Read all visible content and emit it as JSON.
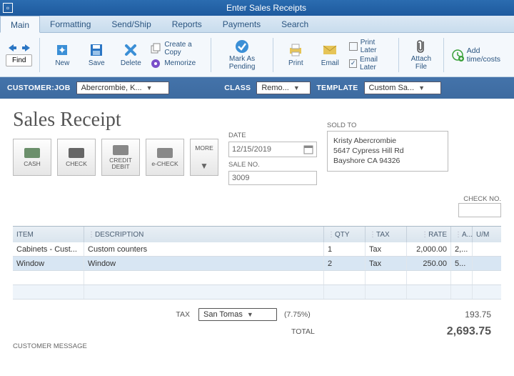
{
  "window": {
    "title": "Enter Sales Receipts"
  },
  "tabs": [
    "Main",
    "Formatting",
    "Send/Ship",
    "Reports",
    "Payments",
    "Search"
  ],
  "ribbon": {
    "find": "Find",
    "new": "New",
    "save": "Save",
    "delete": "Delete",
    "create_copy": "Create a Copy",
    "memorize": "Memorize",
    "mark_pending": "Mark As Pending",
    "print": "Print",
    "email": "Email",
    "print_later": "Print Later",
    "email_later": "Email Later",
    "attach_file": "Attach File",
    "add_time": "Add time/costs"
  },
  "custbar": {
    "customer_label": "CUSTOMER:JOB",
    "customer": "Abercrombie, K...",
    "class_label": "CLASS",
    "class": "Remo...",
    "template_label": "TEMPLATE",
    "template": "Custom Sa..."
  },
  "receipt": {
    "heading": "Sales Receipt",
    "pay": {
      "cash": "CASH",
      "check": "CHECK",
      "credit": "CREDIT DEBIT",
      "echeck": "e-CHECK",
      "more": "MORE"
    },
    "date_label": "DATE",
    "date": "12/15/2019",
    "saleno_label": "SALE NO.",
    "saleno": "3009",
    "soldto_label": "SOLD TO",
    "soldto_line1": "Kristy Abercrombie",
    "soldto_line2": "5647 Cypress Hill Rd",
    "soldto_line3": "Bayshore CA 94326",
    "checkno_label": "CHECK NO."
  },
  "grid": {
    "headers": {
      "item": "ITEM",
      "desc": "DESCRIPTION",
      "qty": "QTY",
      "tax": "TAX",
      "rate": "RATE",
      "a": "A...",
      "um": "U/M"
    },
    "rows": [
      {
        "item": "Cabinets - Cust...",
        "desc": "Custom counters",
        "qty": "1",
        "tax": "Tax",
        "rate": "2,000.00",
        "a": "2,..."
      },
      {
        "item": "Window",
        "desc": "Window",
        "qty": "2",
        "tax": "Tax",
        "rate": "250.00",
        "a": "5..."
      }
    ]
  },
  "totals": {
    "tax_label": "TAX",
    "tax_dd": "San Tomas",
    "tax_pct": "(7.75%)",
    "tax_amount": "193.75",
    "total_label": "TOTAL",
    "total": "2,693.75"
  },
  "custmsg_label": "CUSTOMER MESSAGE"
}
